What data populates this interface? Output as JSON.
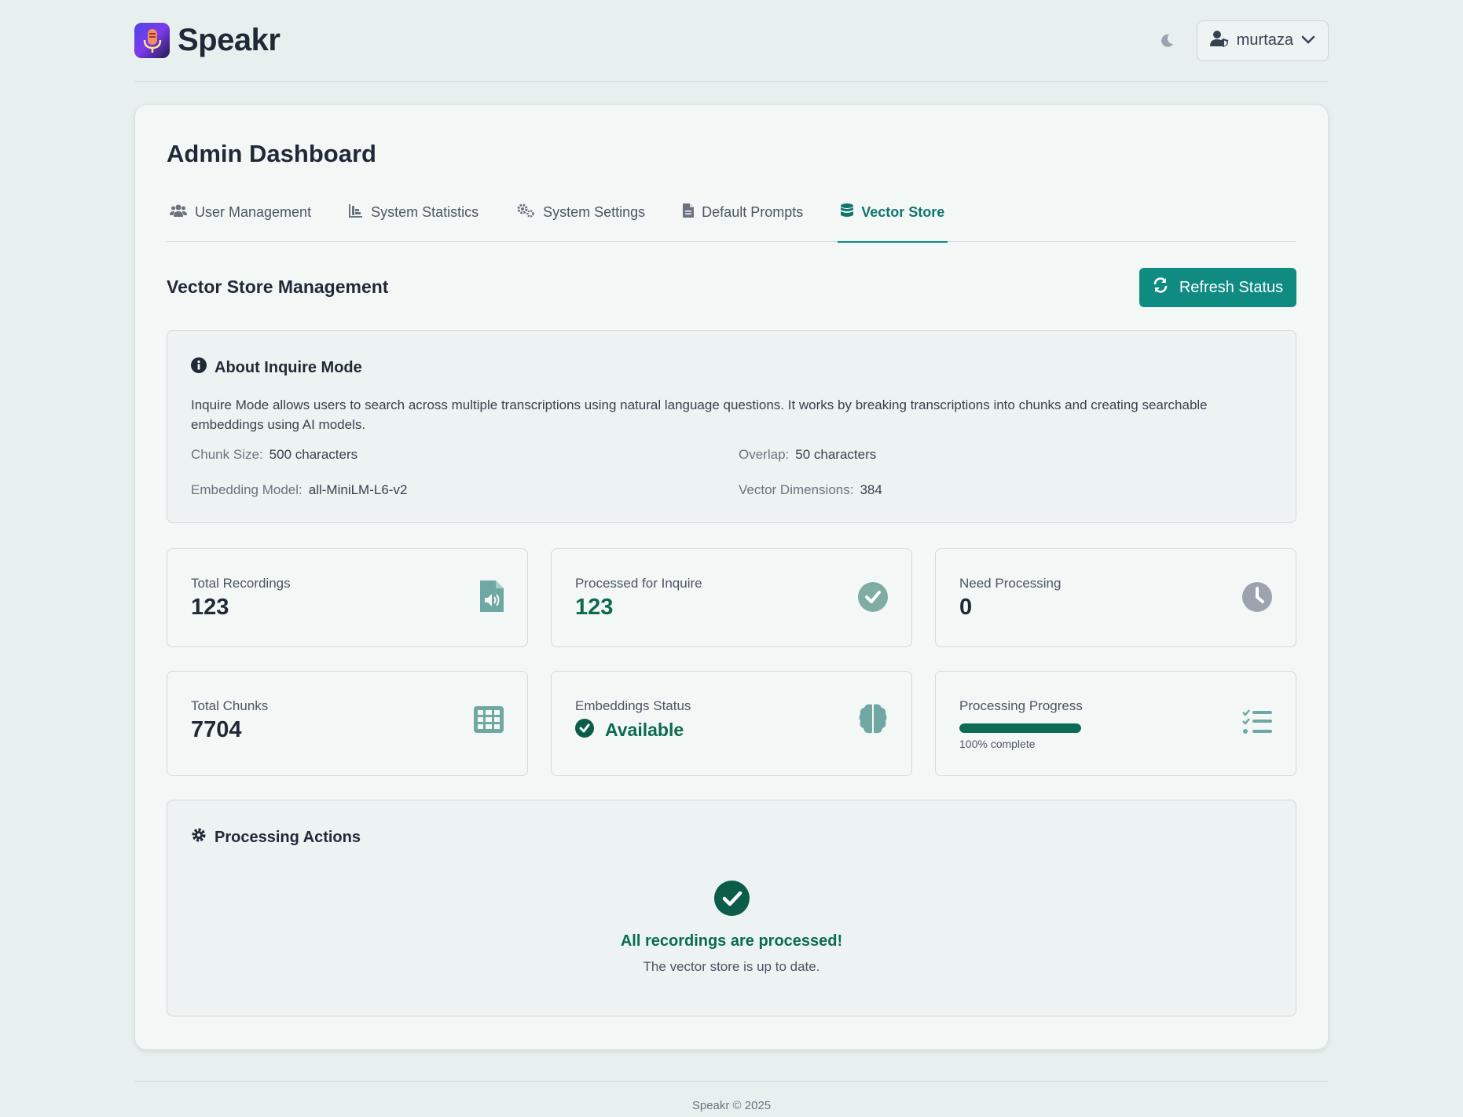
{
  "app": {
    "name": "Speakr"
  },
  "header": {
    "user_name": "murtaza",
    "moon_icon": "moon-icon",
    "user_icon": "user-shield-icon"
  },
  "page": {
    "title": "Admin Dashboard"
  },
  "tabs": [
    {
      "label": "User Management",
      "icon": "users-icon"
    },
    {
      "label": "System Statistics",
      "icon": "chart-bar-icon"
    },
    {
      "label": "System Settings",
      "icon": "cogs-icon"
    },
    {
      "label": "Default Prompts",
      "icon": "file-icon"
    },
    {
      "label": "Vector Store",
      "icon": "database-icon",
      "active": true
    }
  ],
  "section": {
    "title": "Vector Store Management",
    "refresh_label": "Refresh Status"
  },
  "about": {
    "title": "About Inquire Mode",
    "description": "Inquire Mode allows users to search across multiple transcriptions using natural language questions. It works by breaking transcriptions into chunks and creating searchable embeddings using AI models.",
    "chunk_size_label": "Chunk Size:",
    "chunk_size_value": "500 characters",
    "overlap_label": "Overlap:",
    "overlap_value": "50 characters",
    "model_label": "Embedding Model:",
    "model_value": "all-MiniLM-L6-v2",
    "dimensions_label": "Vector Dimensions:",
    "dimensions_value": "384"
  },
  "stats": {
    "total_recordings": {
      "label": "Total Recordings",
      "value": "123"
    },
    "processed": {
      "label": "Processed for Inquire",
      "value": "123"
    },
    "need_processing": {
      "label": "Need Processing",
      "value": "0"
    },
    "total_chunks": {
      "label": "Total Chunks",
      "value": "7704"
    },
    "embeddings": {
      "label": "Embeddings Status",
      "value": "Available"
    },
    "progress": {
      "label": "Processing Progress",
      "percent": 100,
      "text": "100% complete"
    }
  },
  "actions": {
    "title": "Processing Actions",
    "done_title": "All recordings are processed!",
    "done_sub": "The vector store is up to date."
  },
  "footer": {
    "text": "Speakr © 2025"
  },
  "colors": {
    "accent": "#0f8b82",
    "success": "#0b6b4f",
    "background": "#e8f0ef"
  }
}
